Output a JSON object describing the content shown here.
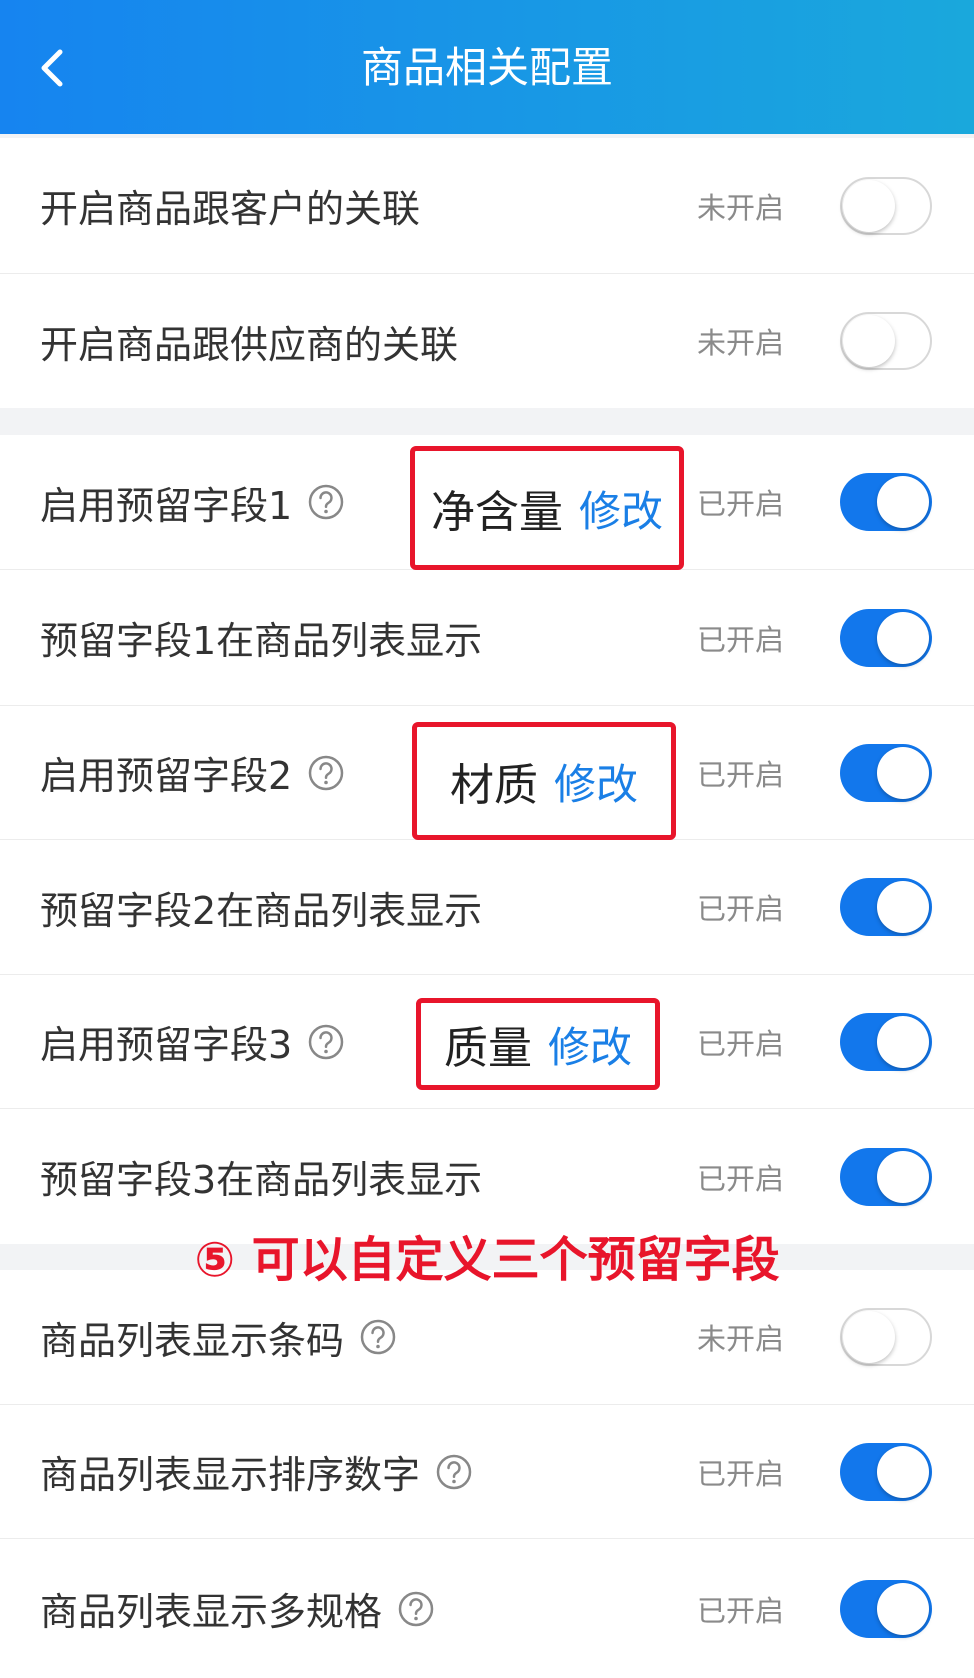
{
  "header": {
    "title": "商品相关配置"
  },
  "rows": [
    {
      "label": "开启商品跟客户的关联",
      "status": "未开启",
      "on": false
    },
    {
      "label": "开启商品跟供应商的关联",
      "status": "未开启",
      "on": false
    },
    {
      "label": "启用预留字段1",
      "status": "已开启",
      "on": true,
      "field_name": "净含量",
      "edit_label": "修改"
    },
    {
      "label": "预留字段1在商品列表显示",
      "status": "已开启",
      "on": true
    },
    {
      "label": "启用预留字段2",
      "status": "已开启",
      "on": true,
      "field_name": "材质",
      "edit_label": "修改"
    },
    {
      "label": "预留字段2在商品列表显示",
      "status": "已开启",
      "on": true
    },
    {
      "label": "启用预留字段3",
      "status": "已开启",
      "on": true,
      "field_name": "质量",
      "edit_label": "修改"
    },
    {
      "label": "预留字段3在商品列表显示",
      "status": "已开启",
      "on": true
    },
    {
      "label": "商品列表显示条码",
      "status": "未开启",
      "on": false
    },
    {
      "label": "商品列表显示排序数字",
      "status": "已开启",
      "on": true
    },
    {
      "label": "商品列表显示多规格",
      "status": "已开启",
      "on": true
    }
  ],
  "annotation": "⑤ 可以自定义三个预留字段",
  "colors": {
    "header_start": "#1684f0",
    "header_end": "#1aa8dc",
    "toggle_on": "#1277ec",
    "highlight_border": "#e8152b",
    "link": "#1a7fe6"
  },
  "icons": {
    "back": "chevron-left-icon",
    "help": "question-circle-icon"
  }
}
